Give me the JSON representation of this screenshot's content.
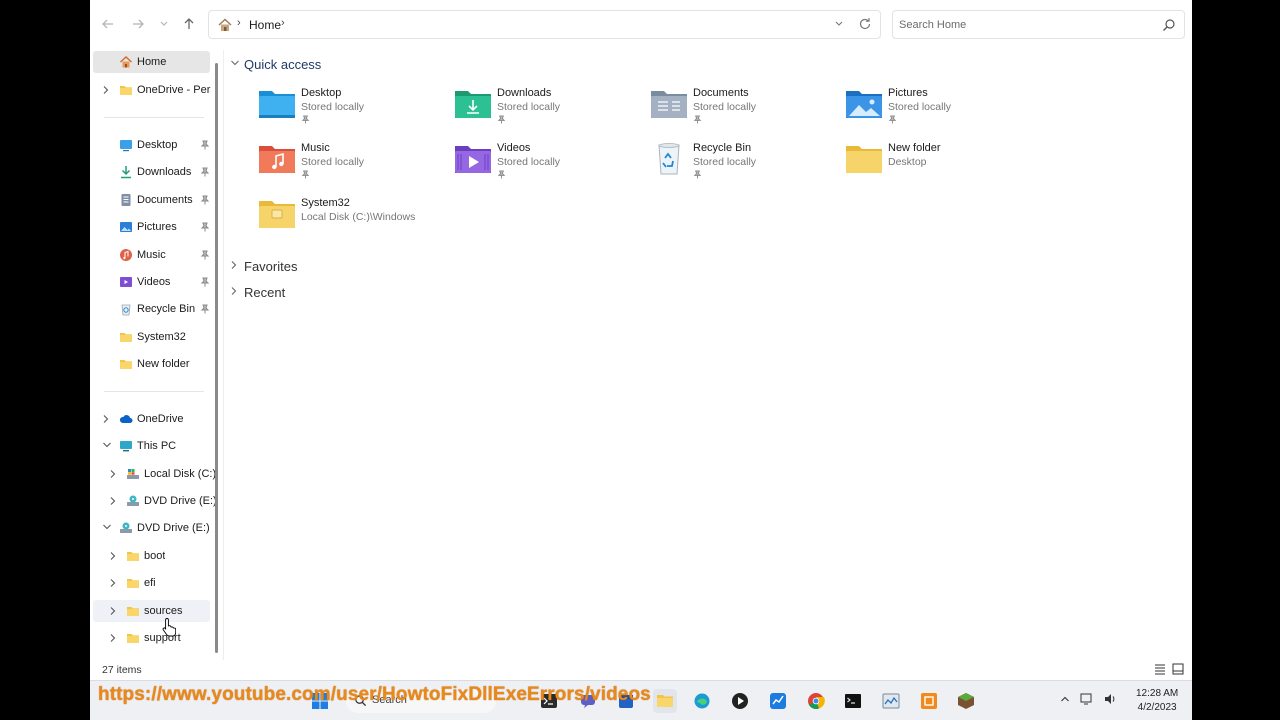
{
  "address": {
    "crumb": "Home",
    "separator": "›"
  },
  "search": {
    "placeholder": "Search Home"
  },
  "nav": {
    "pinned_group": [
      {
        "label": "Home",
        "icon": "home-icon",
        "selected": true
      },
      {
        "label": "OneDrive - Perso",
        "icon": "folder-icon"
      }
    ],
    "quick_links": [
      {
        "label": "Desktop",
        "icon": "desktop-icon",
        "pinned": true
      },
      {
        "label": "Downloads",
        "icon": "download-icon",
        "pinned": true
      },
      {
        "label": "Documents",
        "icon": "document-icon",
        "pinned": true
      },
      {
        "label": "Pictures",
        "icon": "pictures-icon",
        "pinned": true
      },
      {
        "label": "Music",
        "icon": "music-icon",
        "pinned": true
      },
      {
        "label": "Videos",
        "icon": "videos-icon",
        "pinned": true
      },
      {
        "label": "Recycle Bin",
        "icon": "recycle-bin-icon",
        "pinned": true
      },
      {
        "label": "System32",
        "icon": "folder-icon",
        "pinned": false
      },
      {
        "label": "New folder",
        "icon": "folder-icon",
        "pinned": false
      }
    ],
    "tree": [
      {
        "label": "OneDrive",
        "icon": "cloud-icon",
        "expanded": false
      },
      {
        "label": "This PC",
        "icon": "pc-icon",
        "expanded": true
      },
      {
        "label": "Local Disk (C:)",
        "icon": "drive-icon",
        "expanded": false
      },
      {
        "label": "DVD Drive (E:)",
        "icon": "dvd-icon",
        "expanded": false
      },
      {
        "label": "DVD Drive (E:) C",
        "icon": "dvd-icon",
        "expanded": true
      },
      {
        "label": "boot",
        "icon": "folder-icon",
        "expanded": false
      },
      {
        "label": "efi",
        "icon": "folder-icon",
        "expanded": false
      },
      {
        "label": "sources",
        "icon": "folder-icon",
        "expanded": false
      },
      {
        "label": "support",
        "icon": "folder-icon",
        "expanded": false
      }
    ]
  },
  "content": {
    "quick_access_title": "Quick access",
    "favorites_title": "Favorites",
    "recent_title": "Recent",
    "items": [
      {
        "name": "Desktop",
        "sub": "Stored locally",
        "pinned": true,
        "icon": "desktop-folder-icon"
      },
      {
        "name": "Downloads",
        "sub": "Stored locally",
        "pinned": true,
        "icon": "downloads-folder-icon"
      },
      {
        "name": "Documents",
        "sub": "Stored locally",
        "pinned": true,
        "icon": "documents-folder-icon"
      },
      {
        "name": "Pictures",
        "sub": "Stored locally",
        "pinned": true,
        "icon": "pictures-folder-icon"
      },
      {
        "name": "Music",
        "sub": "Stored locally",
        "pinned": true,
        "icon": "music-folder-icon"
      },
      {
        "name": "Videos",
        "sub": "Stored locally",
        "pinned": true,
        "icon": "videos-folder-icon"
      },
      {
        "name": "Recycle Bin",
        "sub": "Stored locally",
        "pinned": true,
        "icon": "recycle-bin-icon"
      },
      {
        "name": "New folder",
        "sub": "Desktop",
        "pinned": false,
        "icon": "folder-icon"
      },
      {
        "name": "System32",
        "sub": "Local Disk (C:)\\Windows",
        "pinned": false,
        "icon": "folder-icon"
      }
    ]
  },
  "status": {
    "count": "27 items"
  },
  "taskbar": {
    "search_label": "Search",
    "time": "12:28 AM",
    "date": "4/2/2023"
  },
  "watermark": "https://www.youtube.com/user/HowtoFixDllExeErrors/videos",
  "colors": {
    "accent": "#0067c0",
    "watermark": "#e8891c",
    "folder": "#f4c542"
  }
}
